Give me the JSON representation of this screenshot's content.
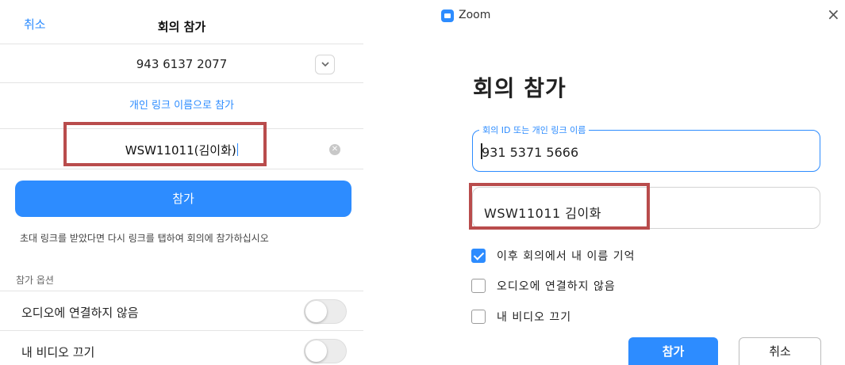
{
  "mobile": {
    "cancel_label": "취소",
    "title": "회의 참가",
    "meeting_id": "943 6137 2077",
    "personal_link_label": "개인 링크 이름으로 참가",
    "name_value": "WSW11011(김이화)",
    "join_button": "참가",
    "hint": "초대 링크를 받았다면 다시 링크를 탭하여 회의에 참가하십시오",
    "options_section": "참가 옵션",
    "options": [
      {
        "label": "오디오에 연결하지 않음",
        "on": false
      },
      {
        "label": "내 비디오 끄기",
        "on": false
      }
    ]
  },
  "desktop": {
    "app_title": "Zoom",
    "close_icon": "×",
    "heading": "회의 참가",
    "id_field_label": "회의 ID 또는 개인 링크 이름",
    "id_value": "931 5371 5666",
    "name_value": "WSW11011 김이화",
    "checkboxes": [
      {
        "label": "이후 회의에서 내 이름 기억",
        "checked": true
      },
      {
        "label": "오디오에 연결하지 않음",
        "checked": false
      },
      {
        "label": "내 비디오 끄기",
        "checked": false
      }
    ],
    "join_button": "참가",
    "cancel_button": "취소"
  },
  "colors": {
    "accent": "#2d8cff",
    "highlight_box": "#b94c4c"
  }
}
